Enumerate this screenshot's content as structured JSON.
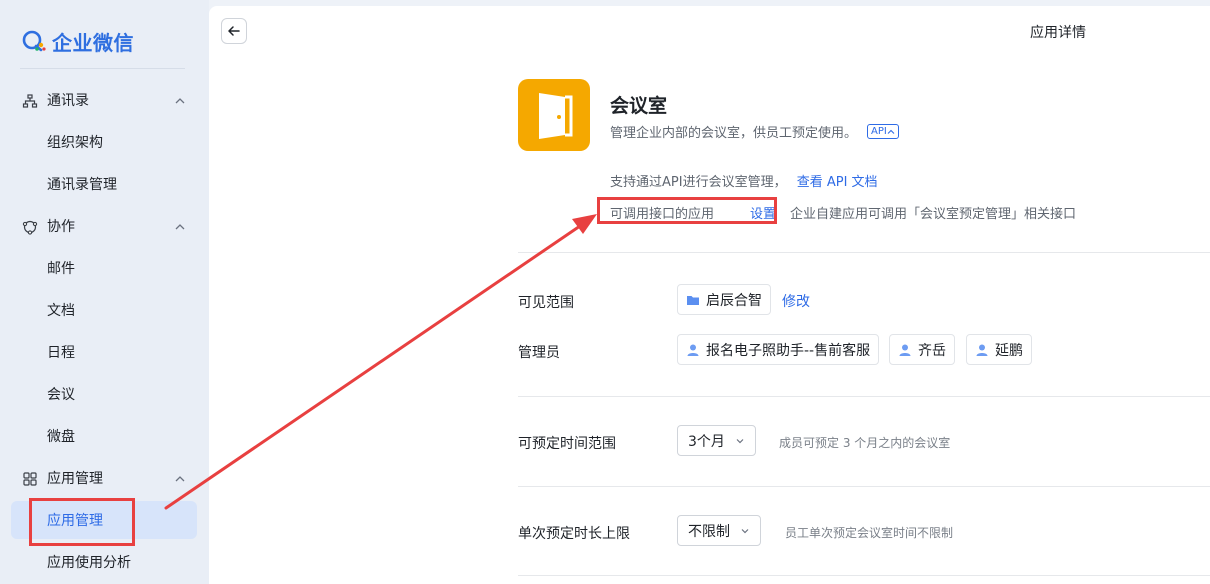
{
  "brand": {
    "name": "企业微信",
    "accent": "#2e6be6"
  },
  "sidebar": {
    "groups": [
      {
        "label": "通讯录",
        "icon": "org-chart-icon",
        "items": [
          "组织架构",
          "通讯录管理"
        ]
      },
      {
        "label": "协作",
        "icon": "collaborate-icon",
        "items": [
          "邮件",
          "文档",
          "日程",
          "会议",
          "微盘"
        ]
      },
      {
        "label": "应用管理",
        "icon": "apps-grid-icon",
        "items": [
          "应用管理",
          "应用使用分析"
        ]
      }
    ],
    "active_item": "应用管理"
  },
  "header": {
    "title": "应用详情"
  },
  "app": {
    "name": "会议室",
    "description": "管理企业内部的会议室，供员工预定使用。",
    "badge": "API",
    "icon_color": "#f5a800"
  },
  "api": {
    "text": "支持通过API进行会议室管理，",
    "doc_link": "查看 API 文档",
    "callable_label": "可调用接口的应用",
    "setup_link": "设置",
    "callable_note": "企业自建应用可调用「会议室预定管理」相关接口"
  },
  "visibility": {
    "label": "可见范围",
    "value": "启辰合智",
    "modify_link": "修改"
  },
  "admins": {
    "label": "管理员",
    "people": [
      "报名电子照助手--售前客服",
      "齐岳",
      "延鹏"
    ]
  },
  "booking_range": {
    "label": "可预定时间范围",
    "value": "3个月",
    "hint": "成员可预定 3 个月之内的会议室"
  },
  "max_duration": {
    "label": "单次预定时长上限",
    "value": "不限制",
    "hint": "员工单次预定会议室时间不限制"
  },
  "annotation_color": "#e84040"
}
